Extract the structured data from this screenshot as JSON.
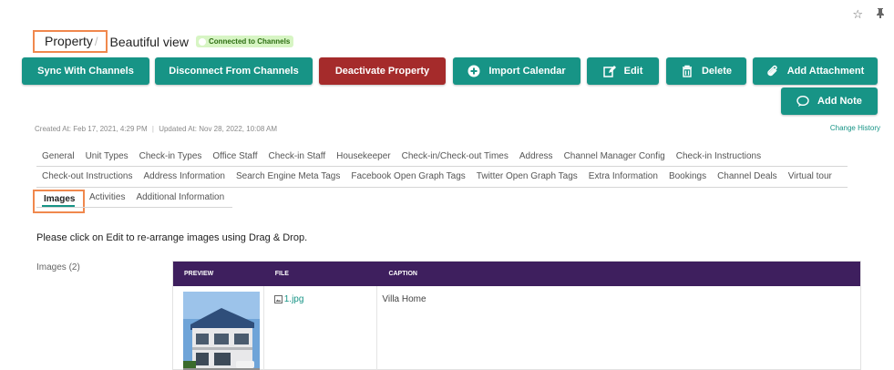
{
  "header": {
    "root": "Property",
    "separator": "/",
    "record_name": "Beautiful view",
    "badge": "Connected to Channels",
    "star_icon": "star-icon",
    "pin_icon": "pin-icon"
  },
  "buttons": {
    "sync": "Sync With Channels",
    "disconnect": "Disconnect From Channels",
    "deactivate": "Deactivate Property",
    "import_calendar": "Import Calendar",
    "edit": "Edit",
    "delete": "Delete",
    "add_attachment": "Add Attachment",
    "add_note": "Add Note"
  },
  "meta": {
    "created": "Created At: Feb 17, 2021, 4:29 PM",
    "divider": "|",
    "updated": "Updated At: Nov 28, 2022, 10:08 AM",
    "change_history": "Change History"
  },
  "tabs": {
    "row1": [
      "General",
      "Unit Types",
      "Check-in Types",
      "Office Staff",
      "Check-in Staff",
      "Housekeeper",
      "Check-in/Check-out Times",
      "Address",
      "Channel Manager Config",
      "Check-in Instructions"
    ],
    "row2": [
      "Check-out Instructions",
      "Address Information",
      "Search Engine Meta Tags",
      "Facebook Open Graph Tags",
      "Twitter Open Graph Tags",
      "Extra Information",
      "Bookings",
      "Channel Deals",
      "Virtual tour"
    ],
    "active": "Images",
    "row3": [
      "Activities",
      "Additional Information"
    ]
  },
  "content": {
    "hint": "Please click on Edit to re-arrange images using Drag & Drop.",
    "images_label": "Images (2)",
    "columns": [
      "PREVIEW",
      "FILE",
      "CAPTION"
    ],
    "rows": [
      {
        "file": "1.jpg",
        "caption": "Villa Home"
      }
    ]
  },
  "colors": {
    "teal": "#179486",
    "red": "#a52b2b",
    "table_header": "#3e1f5e",
    "highlight": "#f0884d"
  }
}
